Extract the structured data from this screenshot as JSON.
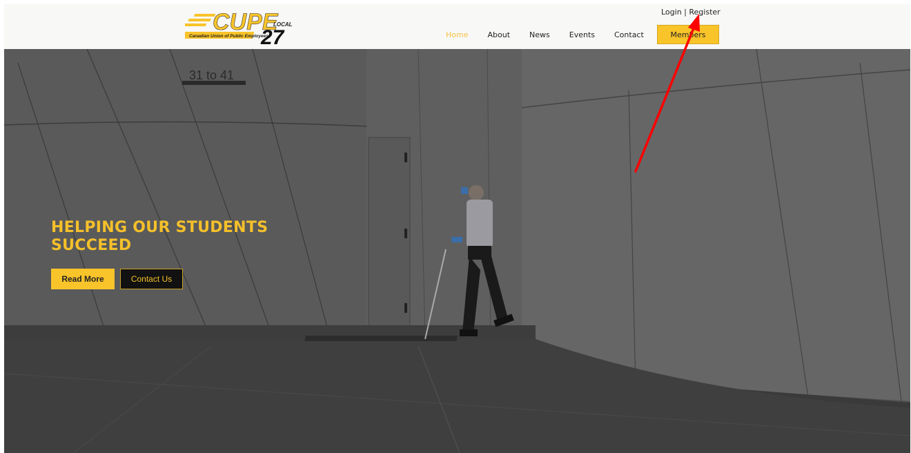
{
  "brand": {
    "logo_text": "CUPE",
    "logo_local": "LOCAL",
    "logo_number": "27",
    "logo_tagline": "Canadian Union of Public Employees",
    "accent_color": "#f9c42a"
  },
  "auth": {
    "login": "Login",
    "separator": " | ",
    "register": "Register"
  },
  "nav": {
    "items": [
      {
        "label": "Home",
        "active": true
      },
      {
        "label": "About",
        "active": false
      },
      {
        "label": "News",
        "active": false
      },
      {
        "label": "Events",
        "active": false
      },
      {
        "label": "Contact",
        "active": false
      }
    ],
    "members_label": "Members"
  },
  "hero": {
    "sign_text": "31 to 41",
    "title": "HELPING OUR STUDENTS SUCCEED",
    "read_more": "Read More",
    "contact_us": "Contact Us"
  },
  "annotation": {
    "arrow_color": "#ff0000"
  }
}
